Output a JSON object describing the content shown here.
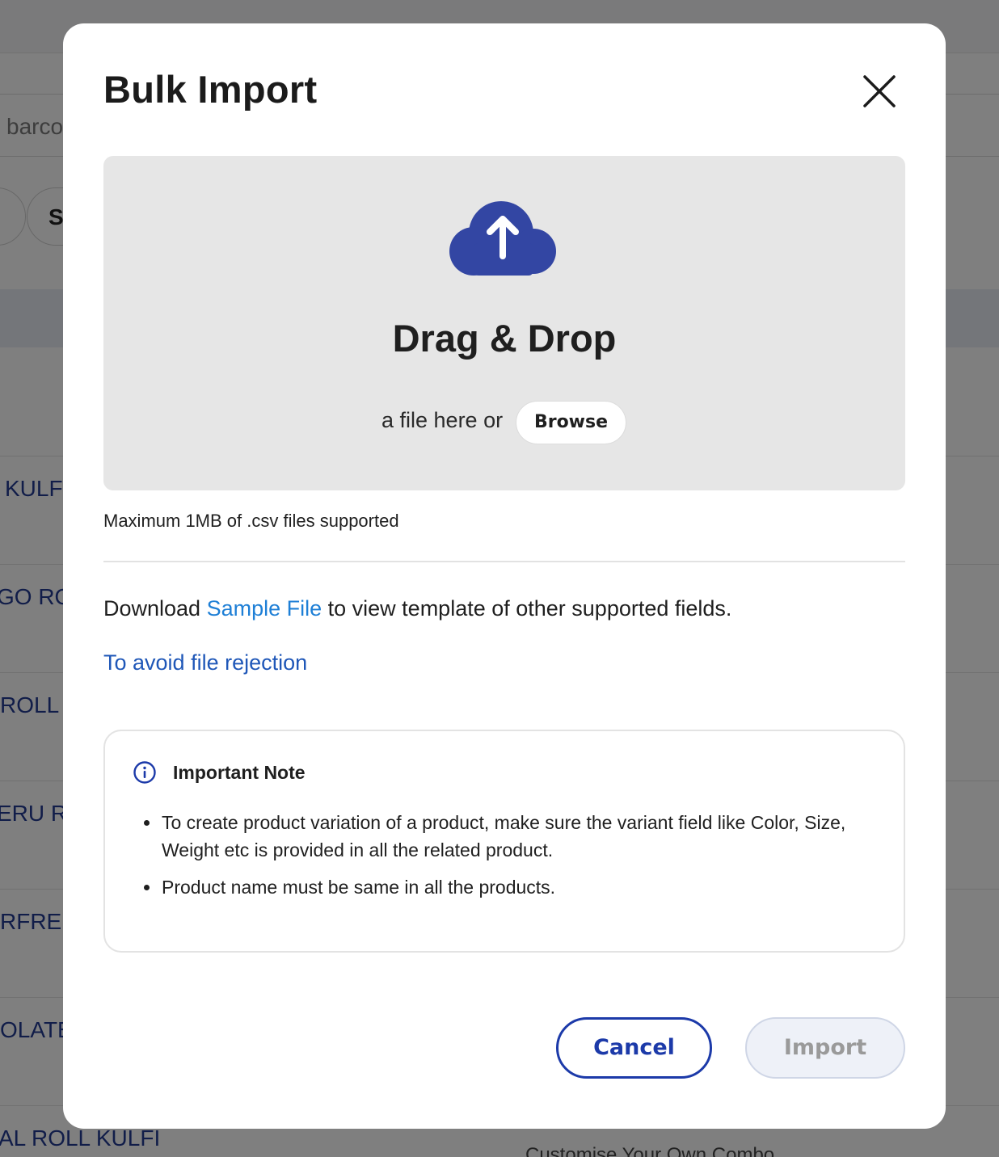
{
  "background": {
    "search_placeholder": "barco",
    "chip_label": "S",
    "rows": [
      "KULFI",
      "GO ROL",
      "ROLL",
      "ERU RO",
      "RFREE",
      "OLATE",
      "AL ROLL KULFI"
    ],
    "footer_text": "Customise Your Own Combo"
  },
  "modal": {
    "title": "Bulk Import",
    "close_icon": "close-icon",
    "dropzone": {
      "icon": "cloud-upload-icon",
      "title": "Drag & Drop",
      "subtitle": "a file here or",
      "browse_label": "Browse"
    },
    "max_note": "Maximum 1MB of .csv files supported",
    "download": {
      "prefix": "Download ",
      "link_text": "Sample File",
      "suffix": " to view template of other supported fields."
    },
    "avoid_link": "To avoid file rejection",
    "note": {
      "icon": "info-icon",
      "title": "Important Note",
      "items": [
        "To create product variation of a product, make sure the variant field like Color, Size, Weight etc is provided in all the related product.",
        "Product name must be same in all the products."
      ]
    },
    "cancel_label": "Cancel",
    "import_label": "Import"
  },
  "colors": {
    "primary": "#1c3aa9",
    "cloud": "#3346a3",
    "link": "#1e7fd6"
  }
}
